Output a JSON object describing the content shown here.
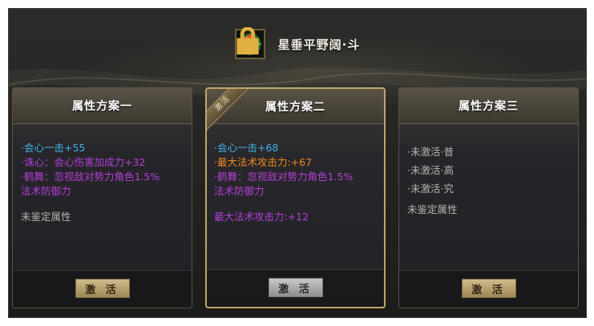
{
  "header": {
    "item_icon": "ornate-medallion-icon",
    "title": "星垂平野阔·斗"
  },
  "cards": [
    {
      "title": "属性方案一",
      "active": false,
      "lines": [
        {
          "text": "·会心一击+55",
          "color": "#3fb4ea"
        },
        {
          "text": "·诛心：会心伤害加成力+32",
          "color": "#b43fd8"
        },
        {
          "text": "·鹤舞：忽视敌对势力角色1.5%",
          "color": "#b43fd8"
        },
        {
          "text": "法术防御力",
          "color": "#b43fd8"
        }
      ],
      "extra": "未鉴定属性",
      "button": "激 活"
    },
    {
      "title": "属性方案二",
      "active": true,
      "ribbon": "激活",
      "lines": [
        {
          "text": "·会心一击+68",
          "color": "#3fb4ea"
        },
        {
          "text": "·最大法术攻击力:+67",
          "color": "#f18a1e"
        },
        {
          "text": "·鹤舞：忽视敌对势力角色1.5%",
          "color": "#b43fd8"
        },
        {
          "text": "法术防御力",
          "color": "#b43fd8"
        }
      ],
      "extra": "最大法术攻击力:+12",
      "button": "激 活"
    },
    {
      "title": "属性方案三",
      "active": false,
      "lines": [
        {
          "text": "·未激活·普",
          "color": "#b7b4ac"
        },
        {
          "text": "·未激活·高",
          "color": "#b7b4ac"
        },
        {
          "text": "·未激活·究",
          "color": "#b7b4ac"
        }
      ],
      "extra": "未鉴定属性",
      "button": "激 活"
    }
  ]
}
